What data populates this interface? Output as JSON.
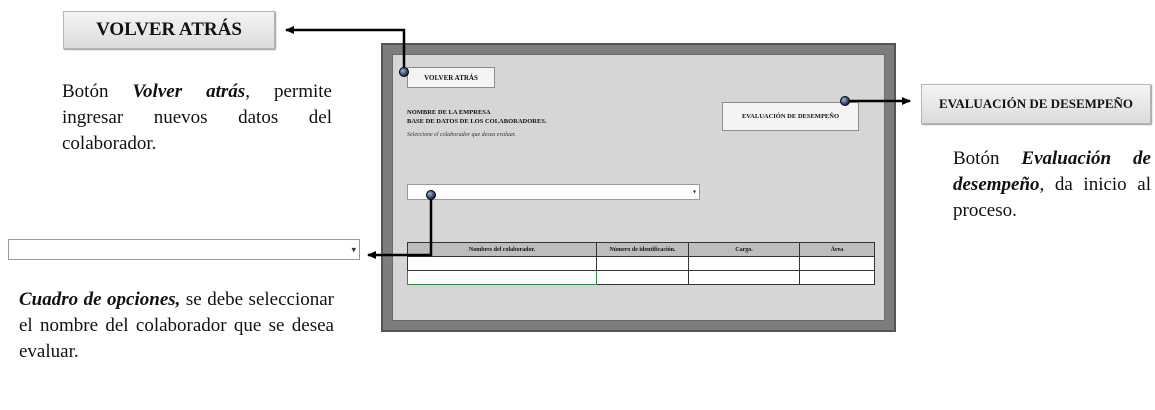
{
  "outer": {
    "back_button_label": "VOLVER ATRÁS",
    "back_desc": {
      "title": "Volver atrás",
      "pre": "Botón ",
      "post": ", permite ingresar nuevos datos del colaborador."
    },
    "eval_button_label": "EVALUACIÓN DE DESEMPEÑO",
    "eval_desc": {
      "pre": "Botón ",
      "title": "Evaluación de desempeño",
      "post": ", da inicio al proceso."
    },
    "combo_desc": {
      "title": "Cuadro de opciones,",
      "post": " se debe seleccionar el nombre del colaborador que  se desea evaluar."
    }
  },
  "screen": {
    "back_button_label": "VOLVER ATRÁS",
    "eval_button_label": "EVALUACIÓN DE DESEMPEÑO",
    "company_name": "NOMBRE DE LA EMPRESA",
    "db_title": "BASE DE DATOS DE LOS COLABORADORES.",
    "instruction": "Seleccione el colaborador que desea evaluar.",
    "combo_value": "",
    "table": {
      "headers": [
        "Nombres del colaborador.",
        "Número de identificación.",
        "Cargo.",
        "Área"
      ],
      "rows": [
        [
          "",
          "",
          "",
          ""
        ],
        [
          "",
          "",
          "",
          ""
        ]
      ]
    }
  },
  "colors": {
    "screen_frame": "#7d7d7d",
    "screen_bg": "#d6d6d6",
    "selection_border": "#2e8b3f"
  }
}
